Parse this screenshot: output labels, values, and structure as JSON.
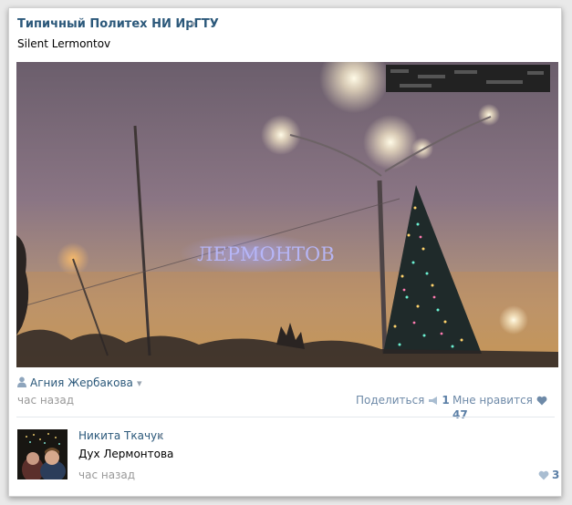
{
  "post": {
    "group_name": "Типичный Политех НИ ИрГТУ",
    "group_caret": "▾",
    "text": "Silent Lermontov",
    "photo_sign_text": "ЛЕРМОНТОВ",
    "author": "Агния Жербакова",
    "author_caret": "▾",
    "time": "час назад",
    "share_label": "Поделиться",
    "share_count": "1",
    "like_label": "Мне нравится",
    "like_count": "47"
  },
  "comment": {
    "author": "Никита Ткачук",
    "author_caret": "▾",
    "text": "Дух Лермонтова",
    "time": "час назад",
    "like_count": "3"
  },
  "icons": {
    "person": "person-icon",
    "megaphone": "megaphone-icon",
    "heart": "heart-icon",
    "caret": "chevron-down-icon"
  },
  "colors": {
    "link": "#2b587a",
    "muted": "#999999",
    "accent": "#5b7fa6"
  }
}
